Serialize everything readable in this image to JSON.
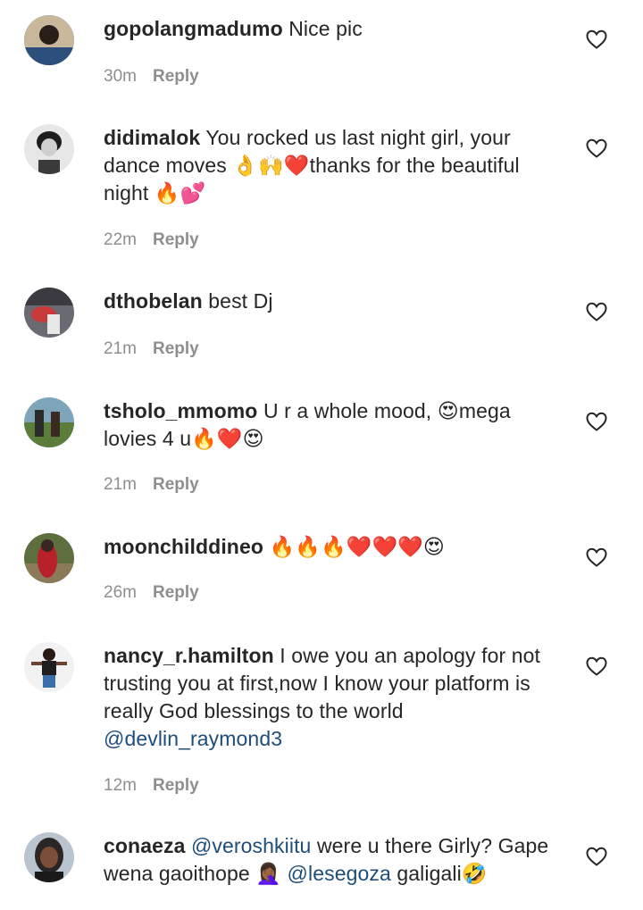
{
  "comments": [
    {
      "username": "gopolangmadumo",
      "text": "Nice pic",
      "time": "30m",
      "reply": "Reply",
      "avatar": {
        "bg": "#3a5f8a",
        "fg": "#2a2a2a"
      }
    },
    {
      "username": "didimalok",
      "text": "You rocked us last night girl, your dance moves 👌🙌❤️thanks for the beautiful night 🔥💕",
      "time": "22m",
      "reply": "Reply",
      "avatar": {
        "bg": "#e7e7e7",
        "fg": "#1e1e1e"
      }
    },
    {
      "username": "dthobelan",
      "text": "best Dj",
      "time": "21m",
      "reply": "Reply",
      "avatar": {
        "bg": "#6a6a72",
        "fg": "#c83a3a"
      }
    },
    {
      "username": "tsholo_mmomo",
      "text": "U r a whole mood, 😍mega lovies 4 u🔥❤️😍",
      "time": "21m",
      "reply": "Reply",
      "avatar": {
        "bg": "#7da4b8",
        "fg": "#5c7d3a"
      }
    },
    {
      "username": "moonchilddineo",
      "text": "🔥🔥🔥❤️❤️❤️😍",
      "time": "26m",
      "reply": "Reply",
      "avatar": {
        "bg": "#5d6e3f",
        "fg": "#b8202a"
      }
    },
    {
      "username": "nancy_r.hamilton",
      "text": "I owe you an apology for not trusting you at first,now I know your platform is really God blessings to the world",
      "mention": "@devlin_raymond3",
      "time": "12m",
      "reply": "Reply",
      "avatar": {
        "bg": "#f2f2f2",
        "fg": "#2a2a2a"
      }
    },
    {
      "username": "conaeza",
      "mention1": "@veroshkiitu",
      "text1": "were u there Girly? Gape wena gaoithope 🤦🏾‍♀️",
      "mention2": "@lesegoza",
      "text2": "galigali🤣",
      "avatar": {
        "bg": "#b9c4cf",
        "fg": "#2a2626"
      }
    }
  ],
  "icons": {
    "like": "heart-outline-icon"
  },
  "colors": {
    "text": "#262626",
    "meta": "#8e8e8e",
    "mention": "#1e4d79"
  }
}
